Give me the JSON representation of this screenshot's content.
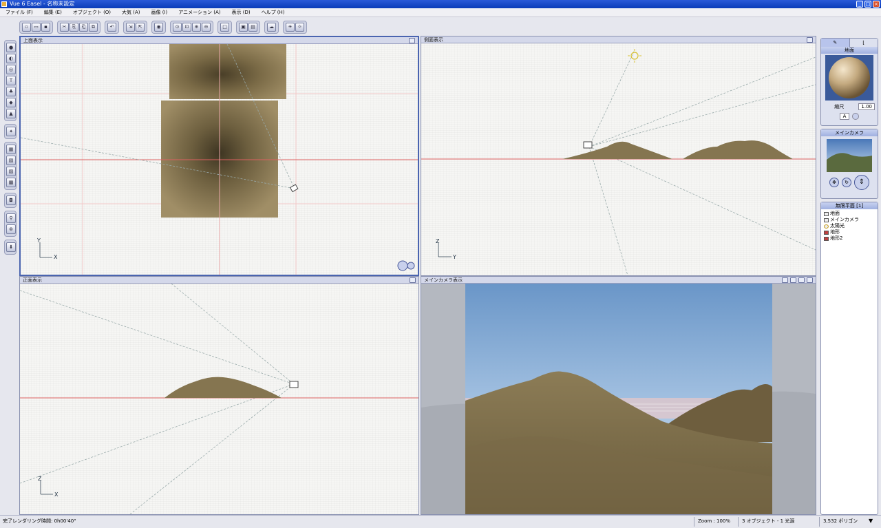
{
  "window": {
    "title": "Vue 6 Easel - 名称未設定"
  },
  "menu": [
    "ファイル (F)",
    "編集 (E)",
    "オブジェクト (O)",
    "大気 (A)",
    "画像 (I)",
    "アニメーション (A)",
    "表示 (D)",
    "ヘルプ (H)"
  ],
  "viewports": {
    "top": {
      "title": "上面表示",
      "axis_v": "Y",
      "axis_h": "X"
    },
    "side": {
      "title": "側面表示",
      "axis_v": "Z",
      "axis_h": "Y"
    },
    "front": {
      "title": "正面表示",
      "axis_v": "Z",
      "axis_h": "X"
    },
    "camera": {
      "title": "メインカメラ表示"
    }
  },
  "material": {
    "label": "地面",
    "scale_label": "縮尺",
    "scale_value": "1.00"
  },
  "camera_panel": {
    "label": "メインカメラ"
  },
  "outliner": {
    "header": "無限平面 [1]",
    "items": [
      {
        "label": "地面",
        "icon": "plane-icon"
      },
      {
        "label": "メインカメラ",
        "icon": "camera-icon"
      },
      {
        "label": "太陽光",
        "icon": "sun-icon"
      },
      {
        "label": "地形",
        "icon": "terrain-icon"
      },
      {
        "label": "地形2",
        "icon": "terrain-icon"
      }
    ]
  },
  "status": {
    "render_time": "完了レンダリング時間: 0h00'40\"",
    "zoom": "Zoom : 100%",
    "objects": "3 オブジェクト - 1 光源",
    "polygons": "3,532 ポリゴン"
  },
  "colors": {
    "accent": "#0a3cb8",
    "terrain": "#8a7a52",
    "sky_top": "#6a96c8",
    "horizon": "#dc8c8c"
  }
}
